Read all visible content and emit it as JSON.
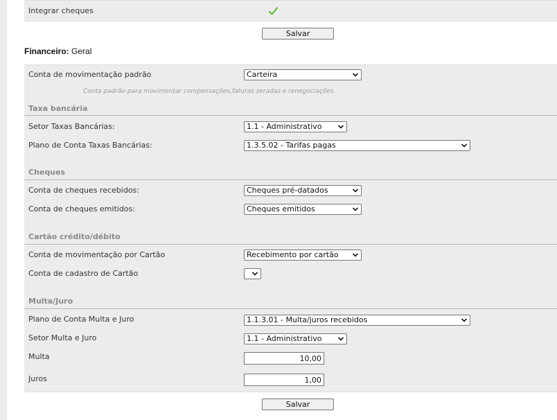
{
  "top": {
    "integrar_label": "Integrar cheques",
    "check_icon": "check-icon",
    "save_label": "Salvar"
  },
  "title": {
    "strong": "Financeiro:",
    "rest": "Geral"
  },
  "main": {
    "conta_mov_label": "Conta de movimentação padrão",
    "conta_mov_value": "Carteira",
    "hint": "Conta padrão para movimentar compensações,faturas zeradas e renegociações.",
    "taxa_section": "Taxa bancária",
    "setor_taxas_label": "Setor Taxas Bancárias:",
    "setor_taxas_value": "1.1 - Administrativo",
    "plano_taxas_label": "Plano de Conta Taxas Bancárias:",
    "plano_taxas_value": "1.3.5.02 - Tarifas pagas",
    "cheques_section": "Cheques",
    "cheques_recebidos_label": "Conta de cheques recebidos:",
    "cheques_recebidos_value": "Cheques pré-datados",
    "cheques_emitidos_label": "Conta de cheques emitidos:",
    "cheques_emitidos_value": "Cheques emitidos",
    "cartao_section": "Cartão crédito/débito",
    "cartao_mov_label": "Conta de movimentação por Cartão",
    "cartao_mov_value": "Recebimento por cartão",
    "cartao_cad_label": "Conta de cadastro de Cartão",
    "cartao_cad_value": "",
    "multa_section": "Multa/Juro",
    "plano_multa_label": "Plano de Conta Multa e Juro",
    "plano_multa_value": "1.1.3.01 - Multa/juros recebidos",
    "setor_multa_label": "Setor Multa e Juro",
    "setor_multa_value": "1.1 - Administrativo",
    "multa_label": "Multa",
    "multa_value": "10,00",
    "juros_label": "Juros",
    "juros_value": "1,00"
  },
  "bottom": {
    "save_label": "Salvar"
  },
  "colors": {
    "panel_bg": "#ececec",
    "section_text": "#8a8a8a",
    "check_green": "#6cbf3c"
  }
}
